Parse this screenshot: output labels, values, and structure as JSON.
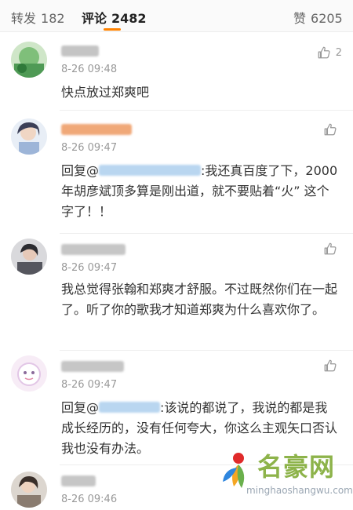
{
  "tabs": {
    "repost": {
      "label": "转发",
      "count": "182"
    },
    "comment": {
      "label": "评论",
      "count": "2482"
    },
    "like": {
      "label": "赞",
      "count": "6205"
    }
  },
  "comments": [
    {
      "time": "8-26 09:48",
      "text": "快点放过郑爽吧",
      "likes": "2"
    },
    {
      "time": "8-26 09:47",
      "reply_prefix": "回复@",
      "text": ":我还真百度了下，2000年胡彦斌顶多算是刚出道，就不要贴着“火” 这个字了！！",
      "likes": ""
    },
    {
      "time": "8-26 09:47",
      "text": "我总觉得张翰和郑爽才舒服。不过既然你们在一起了。听了你的歌我才知道郑爽为什么喜欢你了。",
      "likes": ""
    },
    {
      "time": "8-26 09:47",
      "reply_prefix": "回复@",
      "text": ":该说的都说了，我说的都是我成长经历的，没有任何夸大，你这么主观矢口否认我也没有办法。",
      "likes": ""
    },
    {
      "time": "8-26 09:46",
      "text": "",
      "likes": ""
    }
  ],
  "watermark": {
    "brand": "名豪网",
    "url": "minghaoshangwu.com"
  },
  "colors": {
    "accent": "#ff8200",
    "link": "#4a86c5"
  }
}
